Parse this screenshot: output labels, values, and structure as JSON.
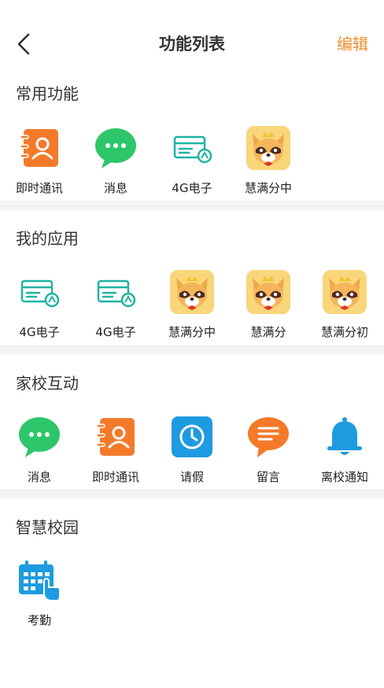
{
  "header": {
    "title": "功能列表",
    "edit_label": "编辑"
  },
  "sections": [
    {
      "title": "常用功能",
      "items": [
        {
          "label": "即时通讯",
          "icon": "contact-book-icon"
        },
        {
          "label": "消息",
          "icon": "chat-bubble-icon"
        },
        {
          "label": "4G电子",
          "icon": "card-icon"
        },
        {
          "label": "慧满分中",
          "icon": "fox-mascot-icon"
        }
      ]
    },
    {
      "title": "我的应用",
      "items": [
        {
          "label": "4G电子",
          "icon": "card-icon"
        },
        {
          "label": "4G电子",
          "icon": "card-icon"
        },
        {
          "label": "慧满分中",
          "icon": "fox-mascot-icon"
        },
        {
          "label": "慧满分",
          "icon": "fox-mascot-icon"
        },
        {
          "label": "慧满分初",
          "icon": "fox-mascot-icon"
        }
      ]
    },
    {
      "title": "家校互动",
      "items": [
        {
          "label": "消息",
          "icon": "chat-bubble-icon"
        },
        {
          "label": "即时通讯",
          "icon": "contact-book-icon"
        },
        {
          "label": "请假",
          "icon": "clock-icon"
        },
        {
          "label": "留言",
          "icon": "message-icon"
        },
        {
          "label": "离校通知",
          "icon": "bell-icon"
        }
      ]
    },
    {
      "title": "智慧校园",
      "items": [
        {
          "label": "考勤",
          "icon": "calendar-tap-icon"
        }
      ]
    }
  ],
  "colors": {
    "accent": "#f28c28",
    "green": "#2ec66a",
    "teal": "#1fb3a3",
    "blue": "#1e9be0",
    "orange": "#f47a2a"
  }
}
